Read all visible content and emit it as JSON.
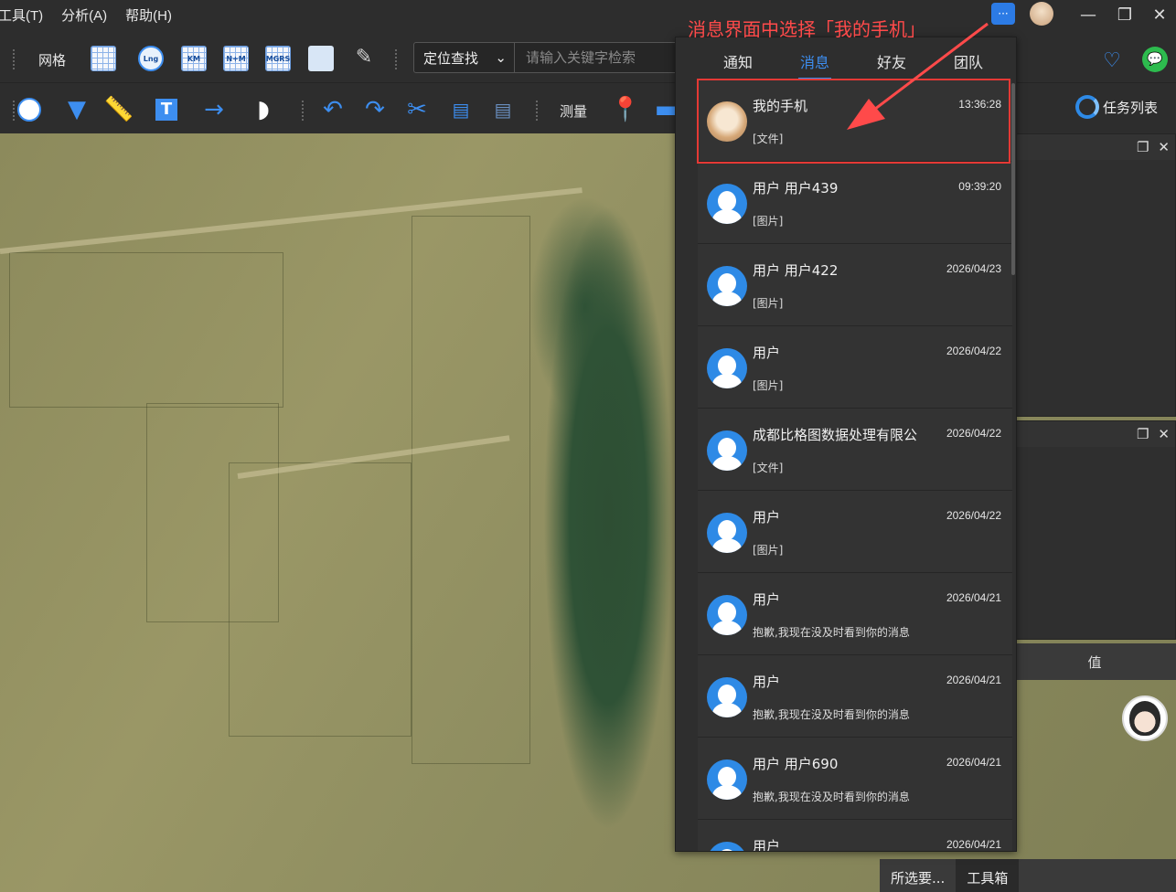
{
  "menu": {
    "items": [
      "工具(T)",
      "分析(A)",
      "帮助(H)"
    ]
  },
  "toolbar1": {
    "grid_label": "网格",
    "icon_labels": [
      "Lng",
      "KM",
      "N+M",
      "MGRS"
    ],
    "search": {
      "mode": "定位查找",
      "placeholder": "请输入关键字检索"
    }
  },
  "toolbar2": {
    "measure_label": "测量"
  },
  "right": {
    "task_list": "任务列表",
    "value_header": "值"
  },
  "bottom_tabs": [
    "所选要...",
    "工具箱"
  ],
  "popup": {
    "tabs": [
      "通知",
      "消息",
      "好友",
      "团队"
    ],
    "active_tab": "消息",
    "messages": [
      {
        "name": "我的手机",
        "preview": "[文件]",
        "time": "13:36:28",
        "avatar": "cat"
      },
      {
        "name": "用户 用户439",
        "preview": "[图片]",
        "time": "09:39:20",
        "avatar": "user"
      },
      {
        "name": "用户 用户422",
        "preview": "[图片]",
        "time": "2026/04/23",
        "avatar": "user"
      },
      {
        "name": "用户",
        "preview": "[图片]",
        "time": "2026/04/22",
        "avatar": "user"
      },
      {
        "name": "成都比格图数据处理有限公",
        "preview": "[文件]",
        "time": "2026/04/22",
        "avatar": "user"
      },
      {
        "name": "用户",
        "preview": "[图片]",
        "time": "2026/04/22",
        "avatar": "user"
      },
      {
        "name": "用户",
        "preview": "抱歉,我现在没及时看到你的消息",
        "time": "2026/04/21",
        "avatar": "user"
      },
      {
        "name": "用户",
        "preview": "抱歉,我现在没及时看到你的消息",
        "time": "2026/04/21",
        "avatar": "user"
      },
      {
        "name": "用户 用户690",
        "preview": "抱歉,我现在没及时看到你的消息",
        "time": "2026/04/21",
        "avatar": "user"
      },
      {
        "name": "用户",
        "preview": "",
        "time": "2026/04/21",
        "avatar": "user"
      }
    ]
  },
  "annotation": {
    "text": "消息界面中选择「我的手机」",
    "color": "#ff4a4a"
  },
  "colors": {
    "accent": "#3d8ef0",
    "highlight": "#e53935"
  }
}
